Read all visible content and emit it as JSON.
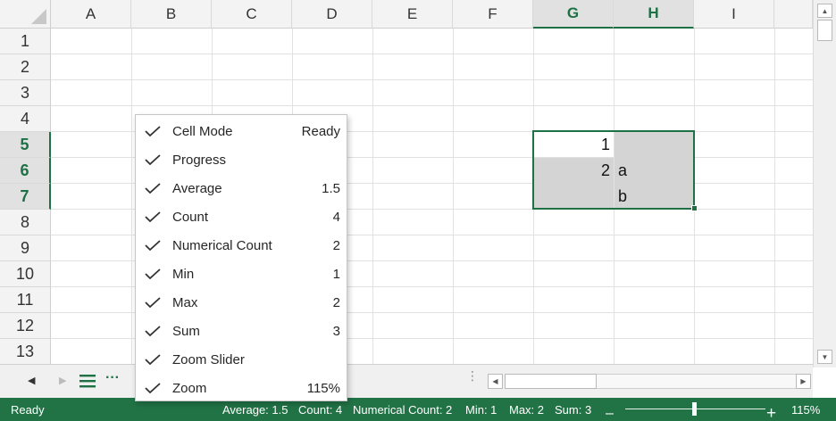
{
  "grid": {
    "columns": [
      "A",
      "B",
      "C",
      "D",
      "E",
      "F",
      "G",
      "H",
      "I"
    ],
    "rows": [
      "1",
      "2",
      "3",
      "4",
      "5",
      "6",
      "7",
      "8",
      "9",
      "10",
      "11",
      "12",
      "13"
    ],
    "cells": {
      "G5": "1",
      "G6": "2",
      "H6": "a",
      "H7": "b"
    }
  },
  "context_menu": {
    "items": [
      {
        "label": "Cell Mode",
        "value": "Ready",
        "checked": true
      },
      {
        "label": "Progress",
        "value": "",
        "checked": true
      },
      {
        "label": "Average",
        "value": "1.5",
        "checked": true
      },
      {
        "label": "Count",
        "value": "4",
        "checked": true
      },
      {
        "label": "Numerical Count",
        "value": "2",
        "checked": true
      },
      {
        "label": "Min",
        "value": "1",
        "checked": true
      },
      {
        "label": "Max",
        "value": "2",
        "checked": true
      },
      {
        "label": "Sum",
        "value": "3",
        "checked": true
      },
      {
        "label": "Zoom Slider",
        "value": "",
        "checked": true
      },
      {
        "label": "Zoom",
        "value": "115%",
        "checked": true
      }
    ]
  },
  "tabbar": {
    "prev_icon": "triangle-left-icon",
    "next_icon": "triangle-right-icon",
    "sheets_icon": "hamburger-menu-icon",
    "more_icon": "ellipsis-icon",
    "more_label": "···"
  },
  "statusbar": {
    "mode": "Ready",
    "average": "Average: 1.5",
    "count": "Count: 4",
    "numerical_count": "Numerical Count: 2",
    "min": "Min: 1",
    "max": "Max: 2",
    "sum": "Sum: 3",
    "zoom_minus": "–",
    "zoom_plus": "+",
    "zoom": "115%",
    "zoom_level_percent": 115
  },
  "colors": {
    "accent": "#217346",
    "selection_border": "#1e7145",
    "selection_fill": "#d4d4d4",
    "header_bg": "#f3f3f3"
  }
}
